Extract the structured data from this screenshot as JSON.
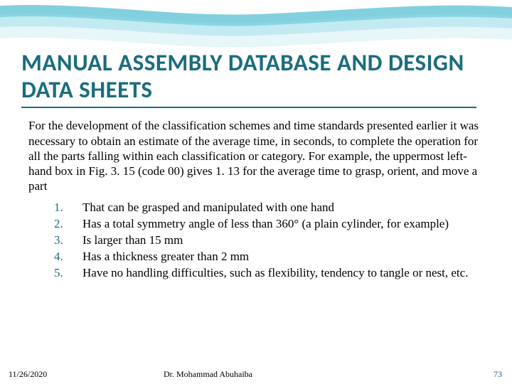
{
  "title": "MANUAL ASSEMBLY DATABASE AND DESIGN DATA SHEETS",
  "paragraph": "For the development of the classification schemes and time standards presented earlier it was necessary to obtain an estimate of the average time, in seconds, to complete the operation for all the parts falling within each classification or category. For example, the uppermost left-hand box in Fig. 3. 15 (code 00) gives 1. 13 for the average time to grasp, orient, and move a part",
  "list": [
    {
      "num": "1.",
      "text": "That can be grasped and manipulated with one hand"
    },
    {
      "num": "2.",
      "text": "Has a total symmetry angle of less than 360° (a plain cylinder, for example)"
    },
    {
      "num": "3.",
      "text": "Is larger than 15 mm"
    },
    {
      "num": "4.",
      "text": "Has a thickness greater than 2 mm"
    },
    {
      "num": "5.",
      "text": "Have no handling difficulties, such as flexibility, tendency to tangle or nest, etc."
    }
  ],
  "footer": {
    "date": "11/26/2020",
    "author": "Dr. Mohammad Abuhaiba",
    "page": "73"
  }
}
